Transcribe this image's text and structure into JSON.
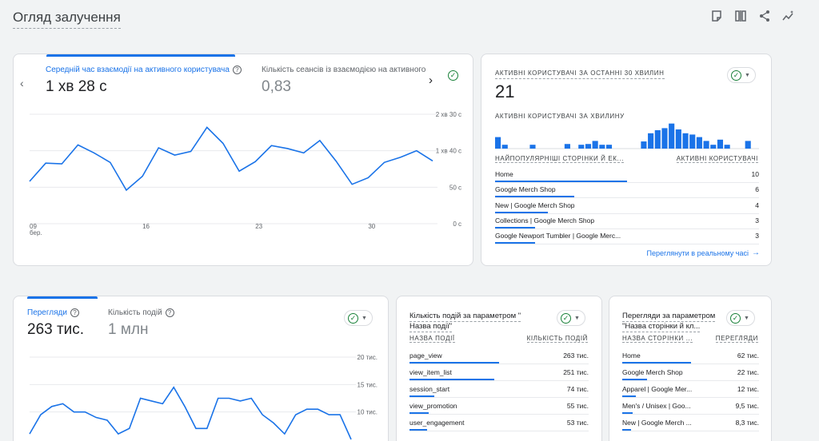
{
  "page": {
    "title": "Огляд залучення"
  },
  "top_icons": [
    "note-icon",
    "compare-icon",
    "share-icon",
    "insights-icon"
  ],
  "engagement_card": {
    "metric1_label": "Середній час взаємодії на активного користувача",
    "metric1_value": "1 хв 28 с",
    "metric2_label": "Кількість сеансів із взаємодією на активного",
    "metric2_value": "0,83",
    "y_ticks": [
      "2 хв 30 с",
      "1 хв 40 с",
      "50 с",
      "0 с"
    ],
    "x_ticks": [
      "09",
      "16",
      "23",
      "30"
    ],
    "x_month": "бер."
  },
  "realtime_card": {
    "title": "АКТИВНІ КОРИСТУВАЧІ ЗА ОСТАННІ 30 ХВИЛИН",
    "value": "21",
    "per_minute_title": "АКТИВНІ КОРИСТУВАЧІ ЗА ХВИЛИНУ",
    "bars": [
      0.45,
      0.15,
      0,
      0,
      0,
      0.15,
      0,
      0,
      0,
      0,
      0.18,
      0,
      0.15,
      0.18,
      0.3,
      0.15,
      0.15,
      0,
      0,
      0,
      0,
      0.28,
      0.6,
      0.72,
      0.8,
      0.98,
      0.75,
      0.6,
      0.55,
      0.45,
      0.3,
      0.15,
      0.35,
      0.15,
      0,
      0,
      0.3,
      0
    ],
    "col_page": "НАЙПОПУЛЯРНІШІ СТОРІНКИ Й ЕК...",
    "col_users": "АКТИВНІ КОРИСТУВАЧІ",
    "rows": [
      {
        "name": "Home",
        "value": "10",
        "share": 1.0
      },
      {
        "name": "Google Merch Shop",
        "value": "6",
        "share": 0.6
      },
      {
        "name": "New | Google Merch Shop",
        "value": "4",
        "share": 0.4
      },
      {
        "name": "Collections | Google Merch Shop",
        "value": "3",
        "share": 0.3
      },
      {
        "name": "Google Newport Tumbler | Google Merc...",
        "value": "3",
        "share": 0.3
      }
    ],
    "link": "Переглянути в реальному часі"
  },
  "views_card": {
    "metric1_label": "Перегляди",
    "metric1_value": "263 тис.",
    "metric2_label": "Кількість подій",
    "metric2_value": "1 млн",
    "y_ticks": [
      "20 тис.",
      "15 тис.",
      "10 тис."
    ]
  },
  "events_card": {
    "title_line1": "Кількість подій за параметром \"",
    "title_line2": "Назва події\"",
    "col_name": "НАЗВА ПОДІЇ",
    "col_value": "КІЛЬКІСТЬ ПОДІЙ",
    "rows": [
      {
        "name": "page_view",
        "value": "263 тис.",
        "share": 1.0
      },
      {
        "name": "view_item_list",
        "value": "251 тис.",
        "share": 0.95
      },
      {
        "name": "session_start",
        "value": "74 тис.",
        "share": 0.28
      },
      {
        "name": "view_promotion",
        "value": "55 тис.",
        "share": 0.21
      },
      {
        "name": "user_engagement",
        "value": "53 тис.",
        "share": 0.2
      }
    ]
  },
  "pages_card": {
    "title_line1": "Перегляди за параметром",
    "title_line2": "\"Назва сторінки й кл...",
    "col_name": "НАЗВА СТОРІНКИ ...",
    "col_value": "ПЕРЕГЛЯДИ",
    "rows": [
      {
        "name": "Home",
        "value": "62 тис.",
        "share": 1.0
      },
      {
        "name": "Google Merch Shop",
        "value": "22 тис.",
        "share": 0.36
      },
      {
        "name": "Apparel | Google Mer...",
        "value": "12 тис.",
        "share": 0.2
      },
      {
        "name": "Men's / Unisex | Goo...",
        "value": "9,5 тис.",
        "share": 0.15
      },
      {
        "name": "New | Google Merch ...",
        "value": "8,3 тис.",
        "share": 0.13
      }
    ]
  },
  "chart_data": [
    {
      "type": "line",
      "x": [
        "09",
        "10",
        "11",
        "12",
        "13",
        "14",
        "15",
        "16",
        "17",
        "18",
        "19",
        "20",
        "21",
        "22",
        "23",
        "24",
        "25",
        "26",
        "27",
        "28",
        "29",
        "30",
        "31",
        "1",
        "2",
        "3"
      ],
      "series": [
        {
          "values": [
            58,
            83,
            82,
            108,
            97,
            84,
            46,
            65,
            104,
            94,
            99,
            132,
            110,
            72,
            85,
            107,
            103,
            97,
            114,
            86,
            54,
            63,
            84,
            91,
            100,
            86
          ]
        }
      ],
      "ylim": [
        0,
        150
      ],
      "y_tick_labels": [
        "0 с",
        "50 с",
        "1 хв 40 с",
        "2 хв 30 с"
      ],
      "x_tick_labels": [
        "09",
        "16",
        "23",
        "30"
      ],
      "grid": true
    },
    {
      "type": "line",
      "series": [
        {
          "values": [
            6,
            9.5,
            11,
            11.5,
            10,
            10,
            9,
            8.5,
            6,
            7,
            12.5,
            12,
            11.5,
            14.5,
            11,
            7,
            7,
            12.5,
            12.5,
            12,
            12.5,
            9.5,
            8,
            6,
            9.5,
            10.5,
            10.5,
            9.5,
            9.5,
            5
          ]
        }
      ],
      "ylim": [
        5,
        20
      ],
      "y_tick_labels": [
        "10 тис.",
        "15 тис.",
        "20 тис."
      ],
      "grid": true
    }
  ]
}
